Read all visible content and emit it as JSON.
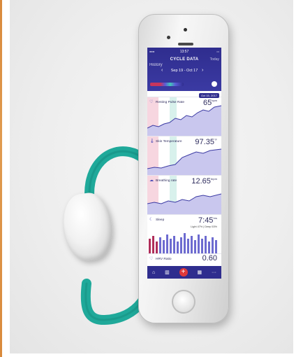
{
  "colors": {
    "app_header": "#2f2d8e",
    "band": "#1fa99a",
    "menstrual": "#c8355c",
    "fertile": "#42c8b8",
    "add_button": "#e0393a"
  },
  "status_bar": {
    "time": "13:57"
  },
  "app": {
    "title": "CYCLE DATA",
    "left_nav": "History",
    "right_nav": "Today",
    "date_range": "Sep 19 - Oct 17",
    "prev_icon": "chevron-left-icon",
    "next_icon": "chevron-right-icon",
    "tooltip": "Oct 15, 2017"
  },
  "panels": [
    {
      "label": "Resting Pulse Rate",
      "value": "65",
      "unit": "bpm",
      "icon": "heart-rate-icon"
    },
    {
      "label": "Skin Temperature",
      "value": "97.35",
      "unit": "°F",
      "icon": "thermometer-icon"
    },
    {
      "label": "Breathing rate",
      "value": "12.65",
      "unit": "brpm",
      "icon": "lungs-icon"
    },
    {
      "label": "Sleep",
      "value": "7:45",
      "unit": "hrs",
      "icon": "sleep-icon",
      "sub": "Light 47% | Deep 53%"
    },
    {
      "label": "HRV Ratio",
      "value": "0.60",
      "unit": "",
      "icon": "hrv-icon"
    }
  ],
  "tabbar": [
    {
      "icon": "home-icon"
    },
    {
      "icon": "chart-icon"
    },
    {
      "icon": "add-icon",
      "label": "+"
    },
    {
      "icon": "calendar-icon"
    },
    {
      "icon": "more-icon",
      "label": "···"
    }
  ]
}
